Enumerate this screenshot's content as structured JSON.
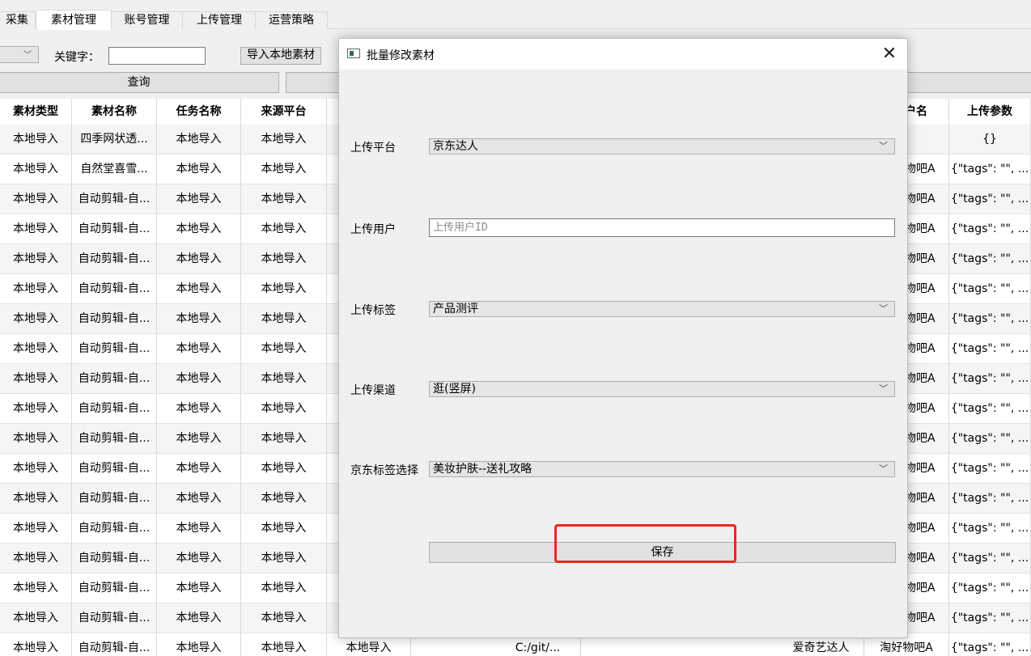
{
  "tabs": [
    "采集",
    "素材管理",
    "账号管理",
    "上传管理",
    "运营策略"
  ],
  "active_tab": 1,
  "toolbar": {
    "keyword_label": "关键字：",
    "import_label": "导入本地素材",
    "query_label": "查询"
  },
  "table": {
    "columns": [
      "素材类型",
      "素材名称",
      "任务名称",
      "来源平台",
      "户名",
      "上传参数"
    ],
    "rows": [
      [
        "本地导入",
        "四季网状透...",
        "本地导入",
        "本地导入",
        "",
        "{}"
      ],
      [
        "本地导入",
        "自然堂喜雪...",
        "本地导入",
        "本地导入",
        "物吧A",
        "{\"tags\": \"\", ..."
      ],
      [
        "本地导入",
        "自动剪辑-自...",
        "本地导入",
        "本地导入",
        "物吧A",
        "{\"tags\": \"\", ..."
      ],
      [
        "本地导入",
        "自动剪辑-自...",
        "本地导入",
        "本地导入",
        "物吧A",
        "{\"tags\": \"\", ..."
      ],
      [
        "本地导入",
        "自动剪辑-自...",
        "本地导入",
        "本地导入",
        "物吧A",
        "{\"tags\": \"\", ..."
      ],
      [
        "本地导入",
        "自动剪辑-自...",
        "本地导入",
        "本地导入",
        "物吧A",
        "{\"tags\": \"\", ..."
      ],
      [
        "本地导入",
        "自动剪辑-自...",
        "本地导入",
        "本地导入",
        "物吧A",
        "{\"tags\": \"\", ..."
      ],
      [
        "本地导入",
        "自动剪辑-自...",
        "本地导入",
        "本地导入",
        "物吧A",
        "{\"tags\": \"\", ..."
      ],
      [
        "本地导入",
        "自动剪辑-自...",
        "本地导入",
        "本地导入",
        "物吧A",
        "{\"tags\": \"\", ..."
      ],
      [
        "本地导入",
        "自动剪辑-自...",
        "本地导入",
        "本地导入",
        "物吧A",
        "{\"tags\": \"\", ..."
      ],
      [
        "本地导入",
        "自动剪辑-自...",
        "本地导入",
        "本地导入",
        "物吧A",
        "{\"tags\": \"\", ..."
      ],
      [
        "本地导入",
        "自动剪辑-自...",
        "本地导入",
        "本地导入",
        "物吧A",
        "{\"tags\": \"\", ..."
      ],
      [
        "本地导入",
        "自动剪辑-自...",
        "本地导入",
        "本地导入",
        "物吧A",
        "{\"tags\": \"\", ..."
      ],
      [
        "本地导入",
        "自动剪辑-自...",
        "本地导入",
        "本地导入",
        "物吧A",
        "{\"tags\": \"\", ..."
      ],
      [
        "本地导入",
        "自动剪辑-自...",
        "本地导入",
        "本地导入",
        "物吧A",
        "{\"tags\": \"\", ..."
      ],
      [
        "本地导入",
        "自动剪辑-自...",
        "本地导入",
        "本地导入",
        "物吧A",
        "{\"tags\": \"\", ..."
      ],
      [
        "本地导入",
        "自动剪辑-自...",
        "本地导入",
        "本地导入",
        "物吧A",
        "{\"tags\": \"\", ..."
      ]
    ],
    "partial_row": [
      "本地导入",
      "自动剪辑-自...",
      "本地导入",
      "本地导入",
      "本地导入",
      "C:/git/...",
      "爱奇艺达人",
      "淘好物吧A",
      "{\"tags\": \"\", ..."
    ]
  },
  "dialog": {
    "title": "批量修改素材",
    "close_glyph": "✕",
    "fields": {
      "platform_label": "上传平台",
      "platform_value": "京东达人",
      "user_label": "上传用户",
      "user_placeholder": "上传用户ID",
      "tag_label": "上传标签",
      "tag_value": "产品测评",
      "channel_label": "上传渠道",
      "channel_value": "逛(竖屏)",
      "jd_tag_label": "京东标签选择",
      "jd_tag_value": "美妆护肤--送礼攻略"
    },
    "save_label": "保存"
  },
  "icons": {
    "dropdown": "chevron-down-icon",
    "window": "window-icon",
    "close": "close-icon"
  },
  "colors": {
    "highlight": "#e8291f"
  }
}
